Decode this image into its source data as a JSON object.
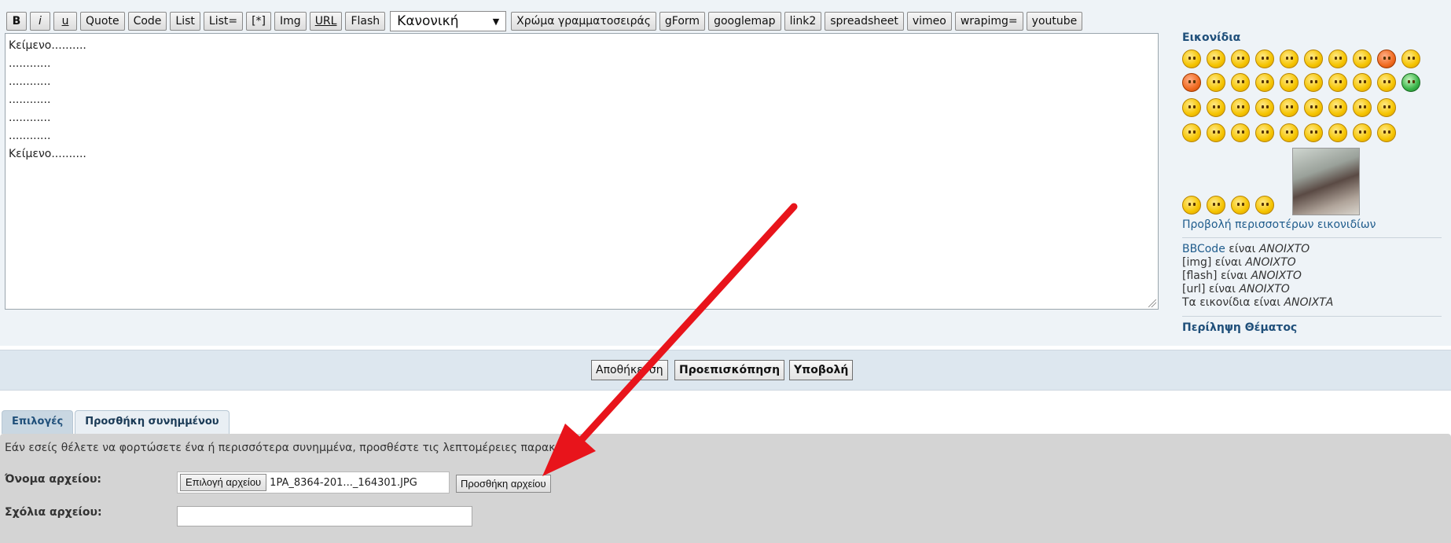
{
  "toolbar": {
    "buttons": {
      "bold": "B",
      "italic": "i",
      "underline": "u",
      "quote": "Quote",
      "code": "Code",
      "list": "List",
      "list_eq": "List=",
      "list_item": "[*]",
      "img": "Img",
      "url": "URL",
      "flash": "Flash"
    },
    "font_size_value": "Κανονική",
    "buttons2": {
      "font_color": "Χρώμα γραμματοσειράς",
      "gform": "gForm",
      "googlemap": "googlemap",
      "link2": "link2",
      "spreadsheet": "spreadsheet",
      "vimeo": "vimeo",
      "wrapimg": "wrapimg=",
      "youtube": "youtube"
    }
  },
  "message": {
    "lines": [
      "Κείμενο..........",
      "............",
      "............",
      "............",
      "............",
      "............",
      "Κείμενο.........."
    ]
  },
  "sidebar": {
    "smilies_title": "Εικονίδια",
    "view_more": "Προβολή περισσοτέρων εικονιδίων",
    "status": {
      "bbcode_label": "BBCode",
      "bbcode_mid": " είναι ",
      "bbcode_val": "ΑΝΟΙΧΤΟ",
      "img_label": "[img] είναι ",
      "img_val": "ΑΝΟΙΧΤΟ",
      "flash_label": "[flash] είναι ",
      "flash_val": "ΑΝΟΙΧΤΟ",
      "url_label": "[url] είναι ",
      "url_val": "ΑΝΟΙΧΤΟ",
      "smilies_label": "Τα εικονίδια είναι ",
      "smilies_val": "ΑΝΟΙΧΤΑ"
    },
    "topic_review": "Περίληψη Θέματος"
  },
  "submit": {
    "save": "Αποθήκευση",
    "preview": "Προεπισκόπηση",
    "submit": "Υποβολή"
  },
  "tabs": {
    "options": "Επιλογές",
    "add_attachment": "Προσθήκη συνημμένου"
  },
  "attachments": {
    "intro": "Εάν εσείς θέλετε να φορτώσετε ένα ή περισσότερα συνημμένα, προσθέστε τις λεπτομέρειες παρακάτω.",
    "filename_label": "Όνομα αρχείου:",
    "choose_file": "Επιλογή αρχείου",
    "selected_file": "1PA_8364-201..._164301.JPG",
    "add_file": "Προσθήκη αρχείου",
    "comment_label": "Σχόλια αρχείου:",
    "comment_value": ""
  },
  "colors": {
    "panel_bg": "#eef3f7",
    "link": "#1f5c8c",
    "heading": "#1f4f7a",
    "arrow": "#e8141b"
  }
}
